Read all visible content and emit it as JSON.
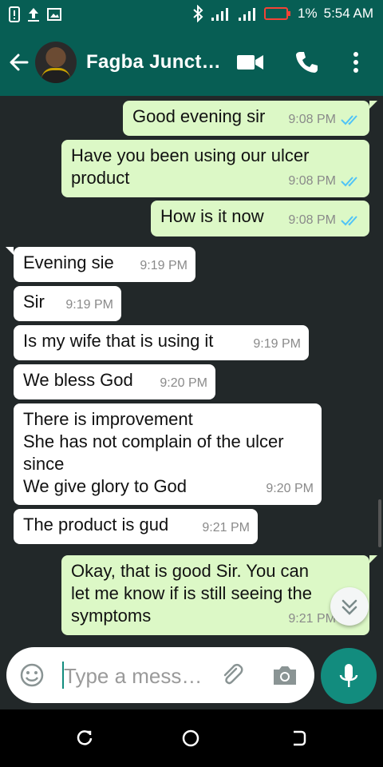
{
  "status_bar": {
    "battery_percent": "1%",
    "time": "5:54 AM",
    "left_icons": [
      "sim-card-icon",
      "upload-icon",
      "image-notification-icon"
    ],
    "right_icons": [
      "bluetooth-icon",
      "signal-icon",
      "signal-icon",
      "battery-low-icon"
    ]
  },
  "header": {
    "title": "Fagba Junct…",
    "icons": [
      "back-arrow-icon",
      "video-call-icon",
      "phone-icon",
      "more-vert-icon"
    ]
  },
  "messages": [
    {
      "dir": "out",
      "lines": [
        "Good evening sir"
      ],
      "time": "9:08 PM",
      "status": "read"
    },
    {
      "dir": "out",
      "lines": [
        "Have you been using our ulcer",
        "product"
      ],
      "time": "9:08 PM",
      "status": "read"
    },
    {
      "dir": "out",
      "lines": [
        "How is it now"
      ],
      "time": "9:08 PM",
      "status": "read"
    },
    {
      "dir": "in",
      "lines": [
        "Evening sie"
      ],
      "time": "9:19 PM"
    },
    {
      "dir": "in",
      "lines": [
        "Sir"
      ],
      "time": "9:19 PM"
    },
    {
      "dir": "in",
      "lines": [
        "Is my wife that is using it"
      ],
      "time": "9:19 PM"
    },
    {
      "dir": "in",
      "lines": [
        "We bless God"
      ],
      "time": "9:20 PM"
    },
    {
      "dir": "in",
      "lines": [
        "There is improvement",
        "She has not complain of the ulcer",
        "since",
        "We give glory to God"
      ],
      "time": "9:20 PM"
    },
    {
      "dir": "in",
      "lines": [
        "The product is gud"
      ],
      "time": "9:21 PM"
    },
    {
      "dir": "out",
      "lines": [
        "Okay, that is good Sir. You can",
        "let me know if is still seeing the",
        "symptoms"
      ],
      "time": "9:21 PM",
      "status": "read"
    }
  ],
  "composer": {
    "placeholder": "Type a mess…",
    "icons": [
      "emoji-icon",
      "attach-icon",
      "camera-icon",
      "mic-icon"
    ]
  },
  "colors": {
    "header": "#075E54",
    "chat_bg": "#222829",
    "outgoing": "#DCF8C6",
    "incoming": "#FFFFFF",
    "accent": "#128C7E",
    "read_tick": "#4FC3F7"
  }
}
